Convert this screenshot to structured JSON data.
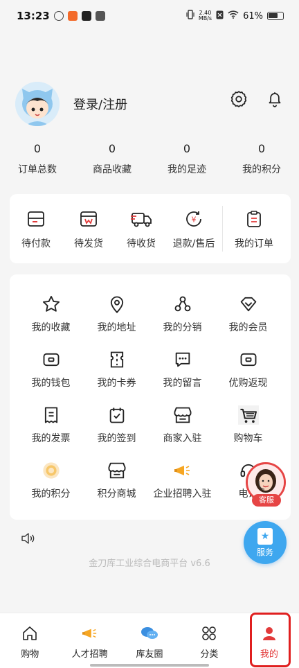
{
  "statusbar": {
    "time": "13:23",
    "speed_top": "2.40",
    "speed_bottom": "MB/s",
    "battery": "61%"
  },
  "profile": {
    "login_label": "登录/注册"
  },
  "stats": [
    {
      "value": "0",
      "label": "订单总数"
    },
    {
      "value": "0",
      "label": "商品收藏"
    },
    {
      "value": "0",
      "label": "我的足迹"
    },
    {
      "value": "0",
      "label": "我的积分"
    }
  ],
  "orders": {
    "items": [
      {
        "label": "待付款",
        "icon": "wallet-icon"
      },
      {
        "label": "待发货",
        "icon": "package-icon"
      },
      {
        "label": "待收货",
        "icon": "truck-icon"
      },
      {
        "label": "退款/售后",
        "icon": "refund-icon"
      }
    ],
    "my_orders": "我的订单"
  },
  "services": [
    [
      {
        "label": "我的收藏",
        "icon": "star-icon"
      },
      {
        "label": "我的地址",
        "icon": "location-icon"
      },
      {
        "label": "我的分销",
        "icon": "share-network-icon"
      },
      {
        "label": "我的会员",
        "icon": "diamond-icon"
      }
    ],
    [
      {
        "label": "我的钱包",
        "icon": "wallet-icon"
      },
      {
        "label": "我的卡券",
        "icon": "coupon-icon"
      },
      {
        "label": "我的留言",
        "icon": "message-icon"
      },
      {
        "label": "优购返现",
        "icon": "cashback-icon"
      }
    ],
    [
      {
        "label": "我的发票",
        "icon": "invoice-icon"
      },
      {
        "label": "我的签到",
        "icon": "checkin-icon"
      },
      {
        "label": "商家入驻",
        "icon": "store-icon"
      },
      {
        "label": "购物车",
        "icon": "cart-icon"
      }
    ],
    [
      {
        "label": "我的积分",
        "icon": "points-coin-icon"
      },
      {
        "label": "积分商城",
        "icon": "store-icon"
      },
      {
        "label": "企业招聘入驻",
        "icon": "megaphone-icon"
      },
      {
        "label": "电话",
        "icon": "phone-icon"
      }
    ]
  ],
  "footer": {
    "version": "金刀库工业综合电商平台 v6.6"
  },
  "floating": {
    "kefu_label": "客服",
    "service_label": "服务"
  },
  "tabs": [
    {
      "label": "购物",
      "icon": "home-icon",
      "active": false
    },
    {
      "label": "人才招聘",
      "icon": "megaphone-icon",
      "active": false
    },
    {
      "label": "库友圈",
      "icon": "chat-bubbles-icon",
      "active": false
    },
    {
      "label": "分类",
      "icon": "grid-icon",
      "active": false
    },
    {
      "label": "我的",
      "icon": "user-icon",
      "active": true
    }
  ],
  "colors": {
    "accent": "#e23a3a",
    "service_blue": "#3ea7ef",
    "highlight_border": "#e01f1f"
  }
}
